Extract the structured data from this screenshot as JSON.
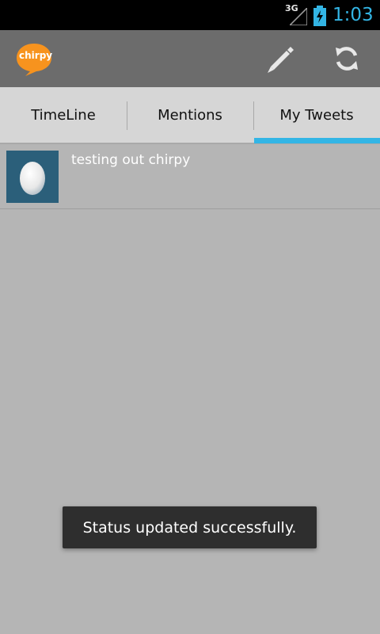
{
  "status_bar": {
    "network_type": "3G",
    "time": "1:03",
    "accent_color": "#33b5e5"
  },
  "action_bar": {
    "logo_text": "chirpy",
    "logo_color": "#f7931e",
    "compose_icon": "pencil-icon",
    "refresh_icon": "refresh-icon"
  },
  "tabs": [
    {
      "label": "TimeLine",
      "selected": false
    },
    {
      "label": "Mentions",
      "selected": false
    },
    {
      "label": "My Tweets",
      "selected": true
    }
  ],
  "tweets": [
    {
      "text": "testing out chirpy",
      "avatar": "egg-avatar-icon"
    }
  ],
  "toast": {
    "message": "Status updated successfully."
  }
}
